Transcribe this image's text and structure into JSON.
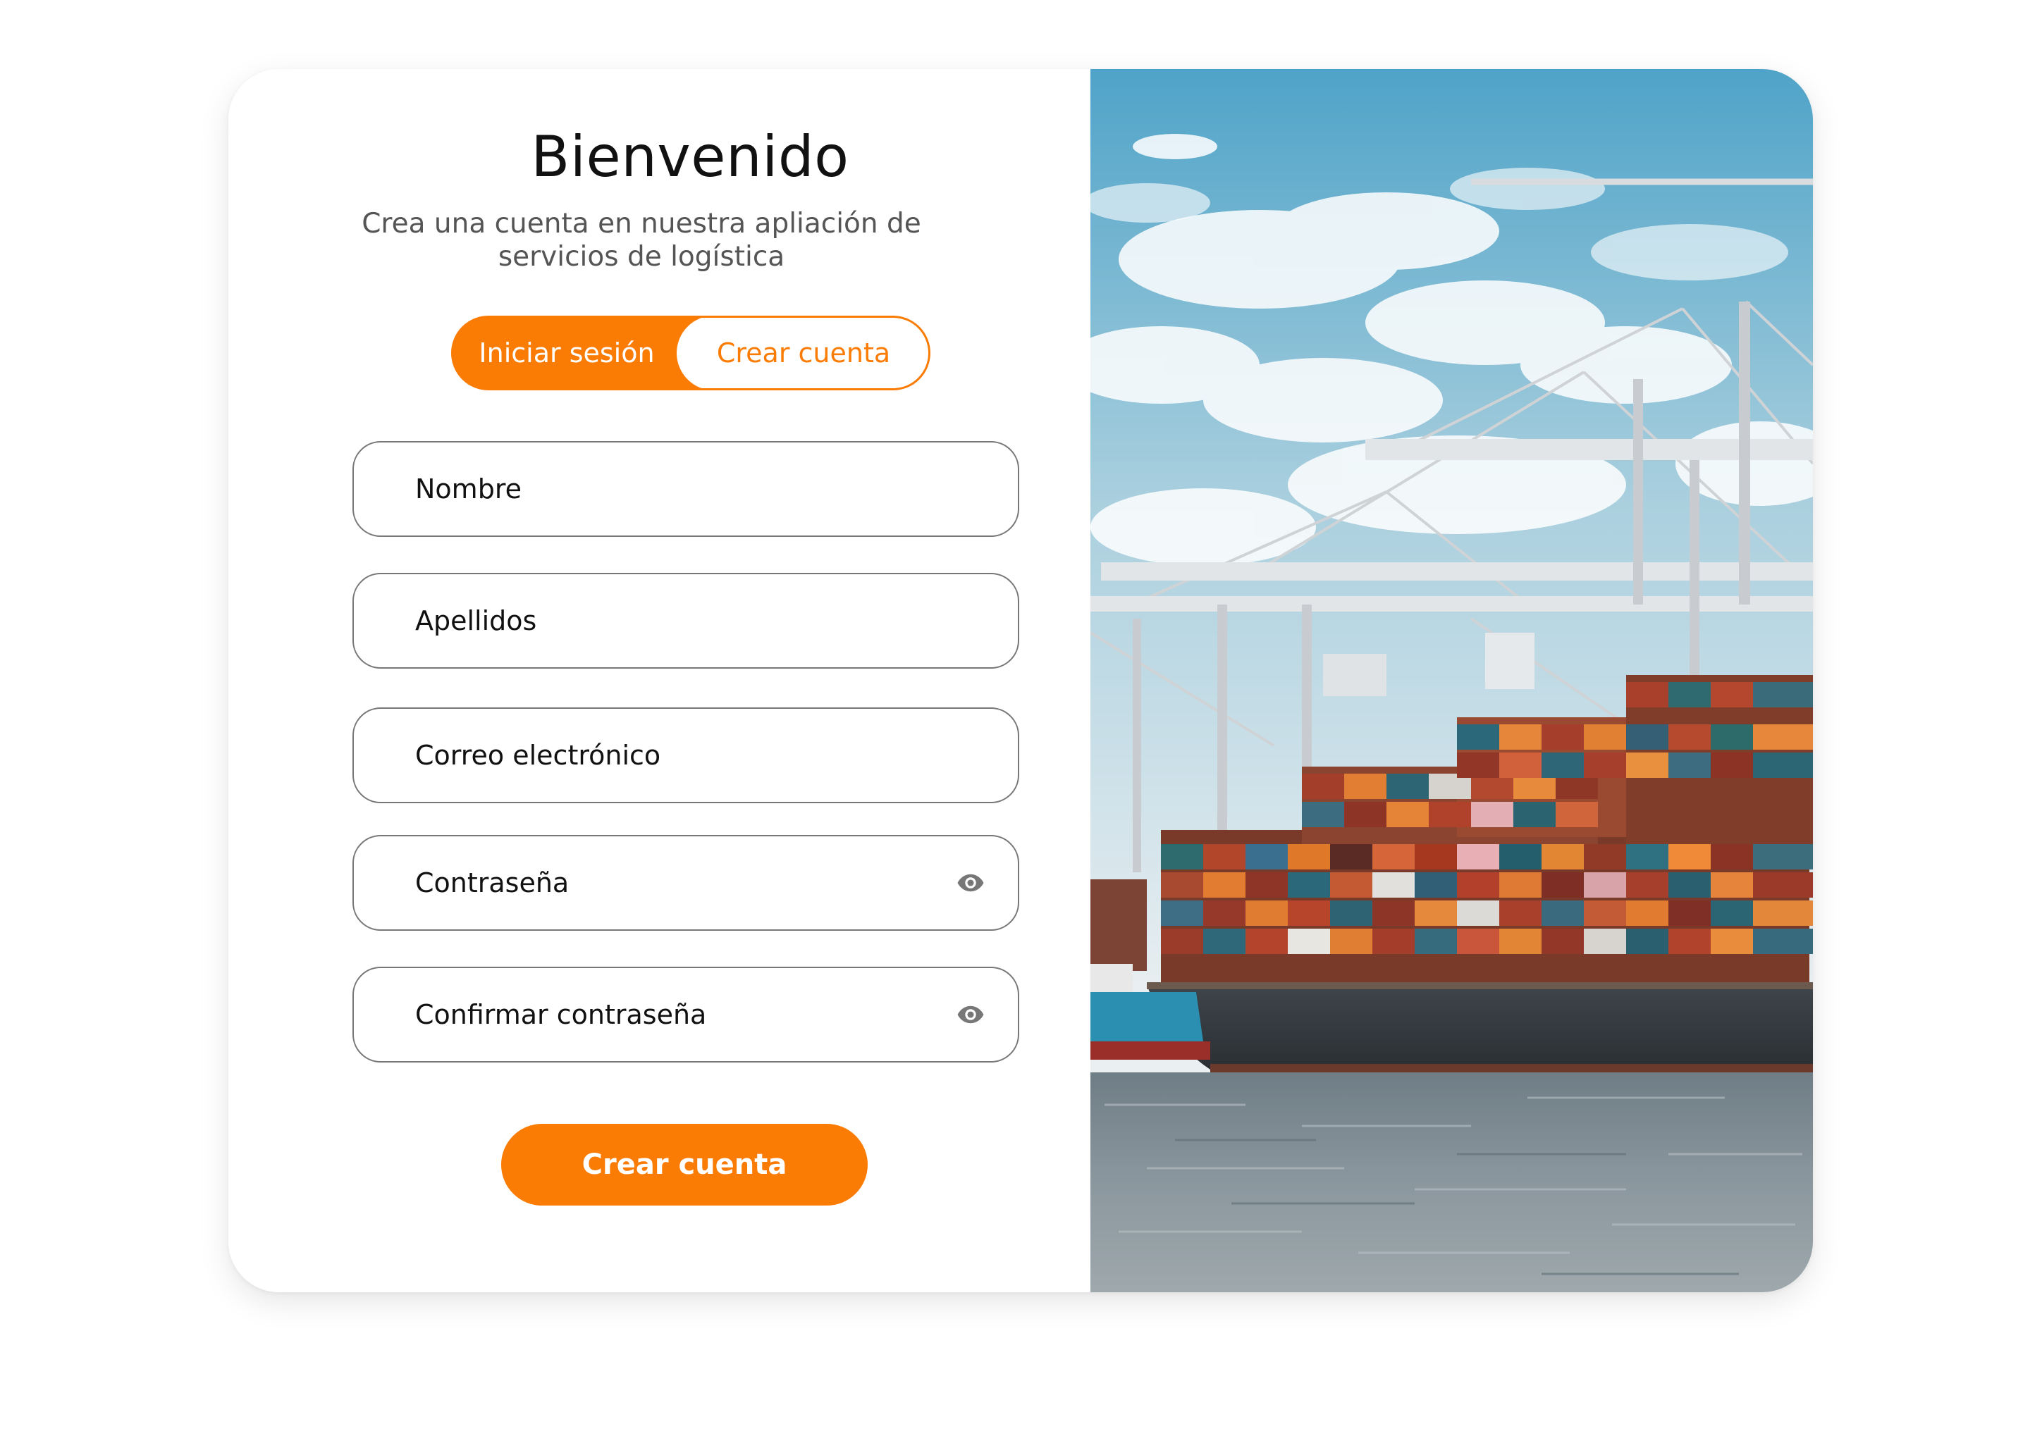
{
  "welcome": {
    "title": "Bienvenido",
    "subtitle": "Crea una cuenta en nuestra apliación de servicios de logística"
  },
  "tabs": {
    "login_label": "Iniciar sesión",
    "signup_label": "Crear cuenta",
    "active": "signup"
  },
  "form": {
    "first_name_label": "Nombre",
    "last_name_label": "Apellidos",
    "email_label": "Correo electrónico",
    "password_label": "Contraseña",
    "confirm_password_label": "Confirmar contraseña",
    "password_toggle_icon": "eye-icon",
    "submit_label": "Crear cuenta"
  },
  "hero_image": {
    "subject": "cargo ship with stacked containers at port cranes"
  },
  "colors": {
    "accent": "#fb7c05",
    "text": "#111111",
    "muted_text": "#555555",
    "field_border": "#777777"
  }
}
